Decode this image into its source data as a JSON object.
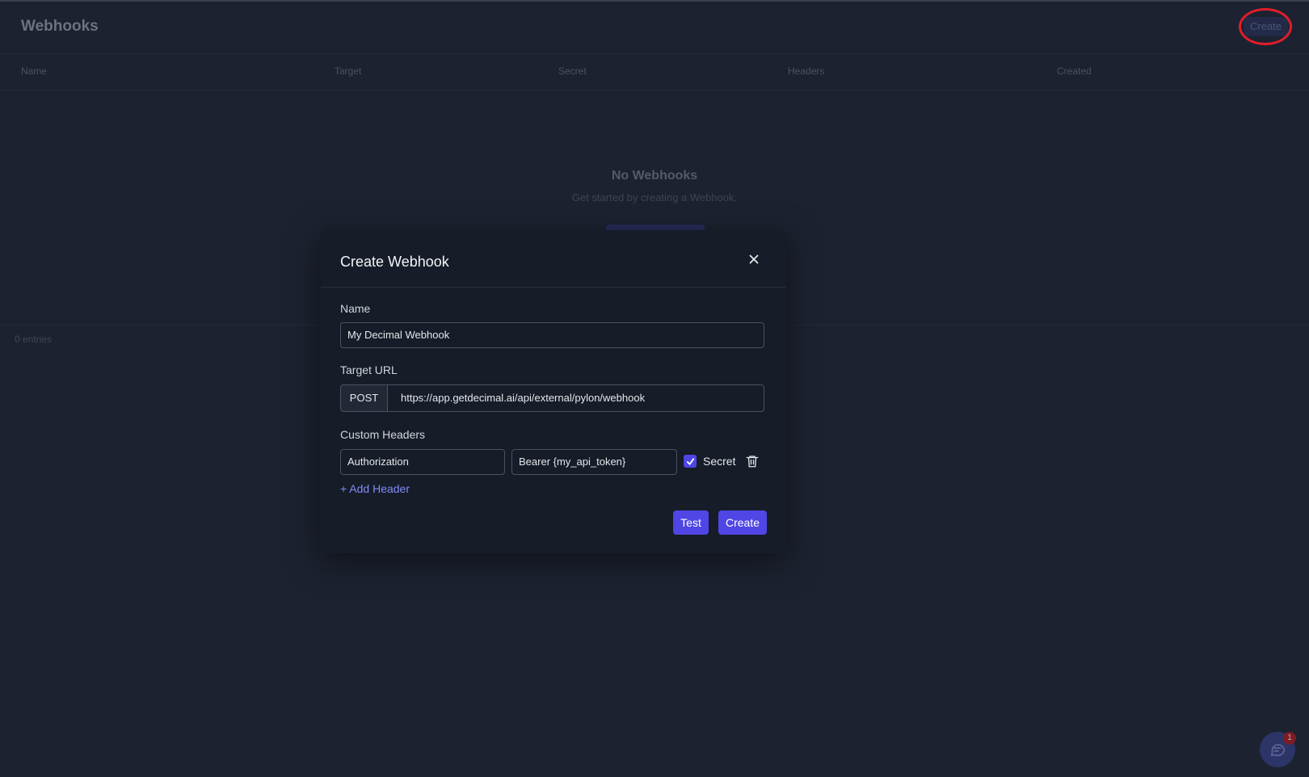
{
  "page": {
    "title": "Webhooks",
    "create_label": "Create",
    "columns": [
      "Name",
      "Target",
      "Secret",
      "Headers",
      "Created"
    ],
    "empty_title": "No Webhooks",
    "empty_subtitle": "Get started by creating a Webhook.",
    "entries_text": "0 entries",
    "chat_badge_count": "1"
  },
  "modal": {
    "title": "Create Webhook",
    "name_label": "Name",
    "name_value": "My Decimal Webhook",
    "target_label": "Target URL",
    "method": "POST",
    "url_value": "https://app.getdecimal.ai/api/external/pylon/webhook",
    "headers_label": "Custom Headers",
    "header_key": "Authorization",
    "header_value": "Bearer {my_api_token}",
    "secret_label": "Secret",
    "secret_checked": true,
    "add_header_label": "+ Add Header",
    "test_label": "Test",
    "create_label": "Create"
  },
  "colors": {
    "accent": "#4f46e5",
    "link": "#818cf8",
    "annotation": "#e11d2a"
  },
  "icons": [
    "close-icon",
    "check-icon",
    "trash-icon",
    "chat-icon"
  ]
}
